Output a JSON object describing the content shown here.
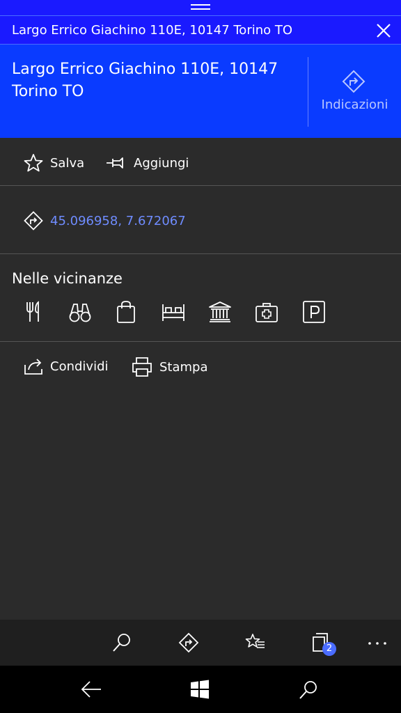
{
  "panel": {
    "title": "Largo Errico Giachino 110E, 10147 Torino TO",
    "address": "Largo Errico Giachino 110E, 10147 Torino TO",
    "directions_label": "Indicazioni"
  },
  "actions": {
    "save_label": "Salva",
    "pin_label": "Aggiungi"
  },
  "location": {
    "coordinates": "45.096958, 7.672067"
  },
  "nearby": {
    "title": "Nelle vicinanze",
    "categories": [
      "fork-knife-icon",
      "binoculars-icon",
      "shopping-bag-icon",
      "bed-icon",
      "museum-icon",
      "first-aid-icon",
      "parking-icon"
    ]
  },
  "share": {
    "share_label": "Condividi",
    "print_label": "Stampa"
  },
  "app_bar": {
    "favorites_badge": "2"
  },
  "colors": {
    "header_blue": "#0a3bff",
    "title_bar_blue": "#1a1aff",
    "link_blue": "#6f8cff",
    "background": "#2b2b2b"
  }
}
